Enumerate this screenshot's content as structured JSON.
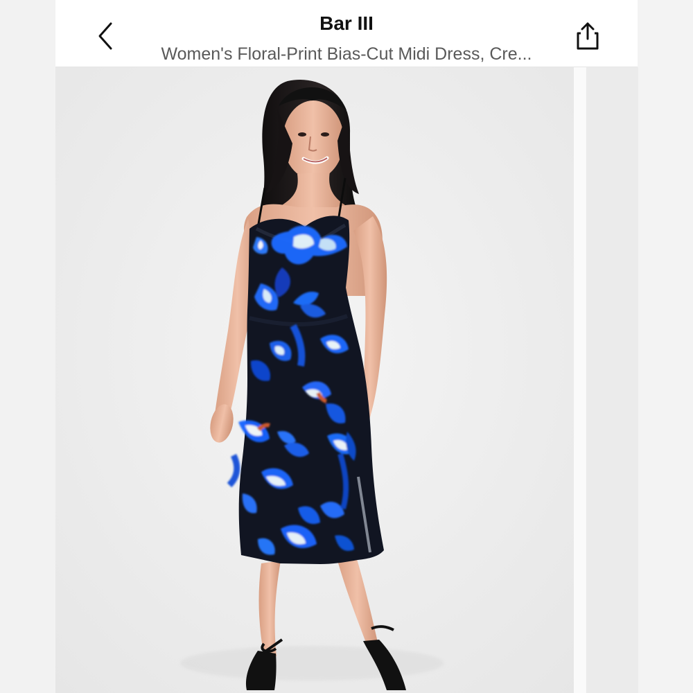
{
  "header": {
    "brand": "Bar III",
    "product_title": "Women's Floral-Print Bias-Cut Midi Dress, Cre...",
    "back_icon": "chevron-left-icon",
    "share_icon": "share-icon"
  },
  "gallery": {
    "current_image": "model-wearing-floral-dress",
    "next_image_visible": true
  },
  "colors": {
    "header_bg": "#ffffff",
    "gallery_bg": "#ececec",
    "dress_base": "#111522",
    "flower_blue": "#1b63f2",
    "flower_light": "#dff4ff",
    "flower_orange": "#c8562a"
  }
}
